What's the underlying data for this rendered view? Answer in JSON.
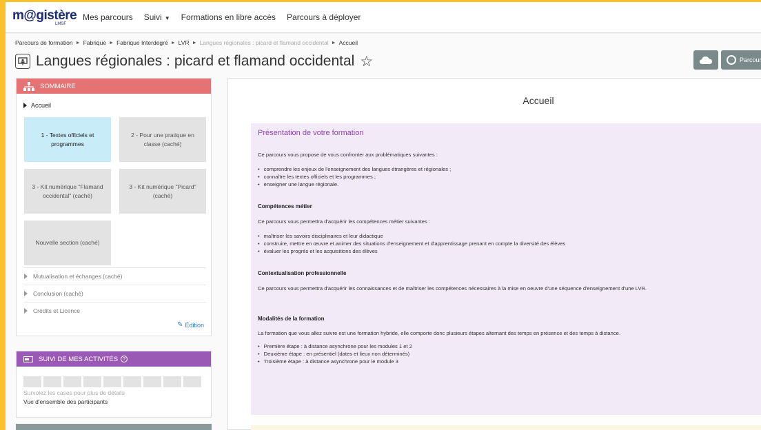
{
  "header": {
    "logo_main": "m@gistère",
    "logo_sub": "LMSF",
    "nav": [
      {
        "label": "Mes parcours"
      },
      {
        "label": "Suivi"
      },
      {
        "label": "Formations en libre accès"
      },
      {
        "label": "Parcours à déployer"
      }
    ]
  },
  "breadcrumb": [
    "Parcours de formation",
    "Fabrique",
    "Fabrique Interdegré",
    "LVR",
    "Langues régionales : picard et flamand occidental",
    "Accueil"
  ],
  "page": {
    "title": "Langues régionales : picard et flamand occidental",
    "parcours_button": "Parcours"
  },
  "sommaire": {
    "header": "SOMMAIRE",
    "accueil": "Accueil",
    "tiles": [
      "1 - Textes officiels et programmes",
      "2 - Pour une pratique en classe (caché)",
      "3 - Kit numérique \"Flamand occidental\" (caché)",
      "3 - Kit numérique \"Picard\" (caché)",
      "Nouvelle section (caché)"
    ],
    "collapsed": [
      "Mutualisation et échanges (caché)",
      "Conclusion (caché)",
      "Crédits et Licence"
    ],
    "edition": "Édition"
  },
  "suivi": {
    "header": "SUIVI DE MES ACTIVITÉS",
    "hint": "Survolez les cases pour plus de détails",
    "overview": "Vue d'ensemble des participants"
  },
  "content": {
    "title": "Accueil",
    "pres_title": "Présentation de votre formation",
    "intro": "Ce parcours vous propose de vous confronter aux problématiques suivantes :",
    "intro_items": [
      "comprendre les enjeux de l'enseignement des langues étrangères et régionales ;",
      "connaître les textes officiels et les programmes ;",
      "enseigner une langue régionale."
    ],
    "competences_title": "Compétences métier",
    "competences_intro": "Ce parcours vous permettra d'acquérir les compétences métier suivantes :",
    "competences_items": [
      "maîtriser les savoirs disciplinaires et leur didactique",
      "construire, mettre en œuvre et animer des situations d'enseignement et d'apprentissage prenant en compte la diversité des élèves",
      "évaluer les progrès et les acquisitions des élèves"
    ],
    "context_title": "Contextualisation professionnelle",
    "context_text": "Ce parcours vous permettra d'acquérir les connaissances et de maîtriser les compétences nécessaires à la mise en oeuvre d'une séquence d'enseignement d'une LVR.",
    "modalites_title": "Modalités de la formation",
    "modalites_text": "La formation que vous allez suivre est une formation hybride, elle comporte donc plusieurs étapes alternant des temps en présence et des temps à distance.",
    "modalites_items": [
      "Première étape : à distance asynchrone pour les modules 1 et 2",
      "Deuxième étape : en présentiel (dates et lieux non déterminés)",
      "Troisième étape : à distance asynchrone pour le module 3"
    ]
  }
}
